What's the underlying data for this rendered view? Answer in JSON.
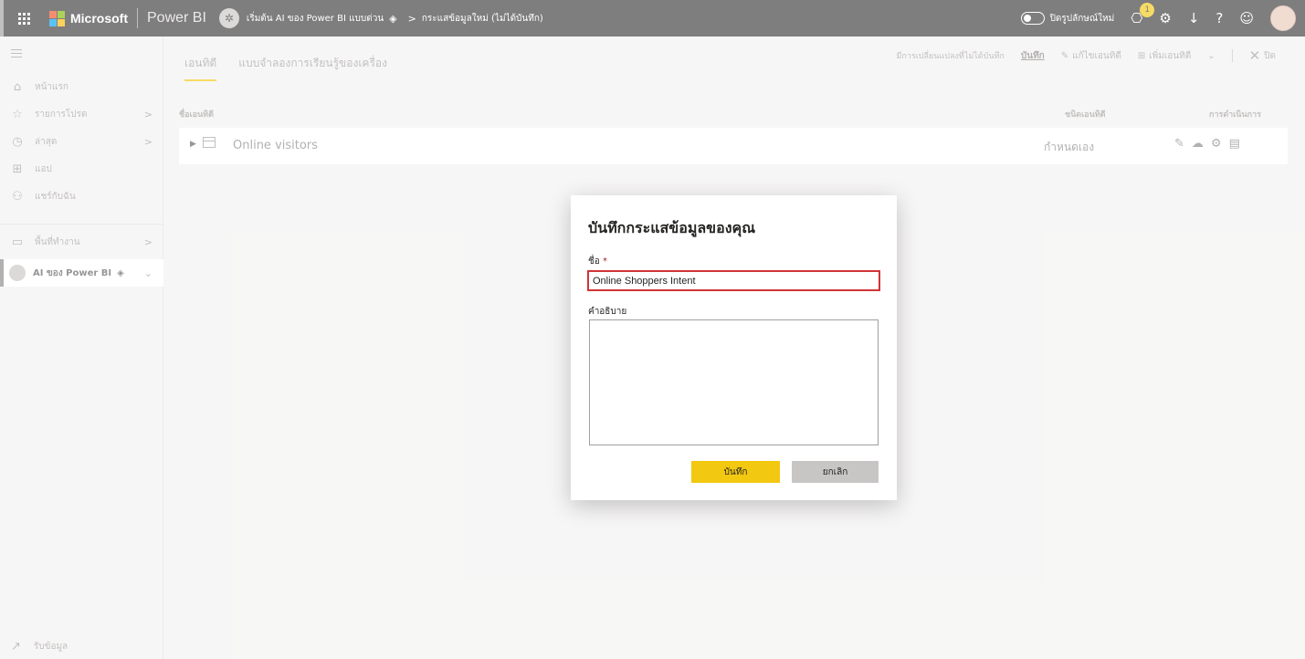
{
  "topbar": {
    "brand": "Microsoft",
    "app": "Power BI",
    "workspace_crumb": "เริ่มต้น AI ของ Power BI แบบด่วน",
    "page_crumb": "กระแสข้อมูลใหม่ (ไม่ได้บันทึก)",
    "new_look_label": "ปิดรูปลักษณ์ใหม่",
    "notification_count": "1"
  },
  "sidebar": {
    "items": [
      {
        "label": "หน้าแรก",
        "icon": "home-icon"
      },
      {
        "label": "รายการโปรด",
        "icon": "star-icon"
      },
      {
        "label": "ล่าสุด",
        "icon": "clock-icon"
      },
      {
        "label": "แอป",
        "icon": "apps-icon"
      },
      {
        "label": "แชร์กับฉัน",
        "icon": "shared-icon"
      },
      {
        "label": "พื้นที่ทำงาน",
        "icon": "workspaces-icon"
      }
    ],
    "active_workspace": "AI ของ Power BI",
    "get_data": "รับข้อมูล"
  },
  "main": {
    "tabs": [
      "เอนทิตี",
      "แบบจำลองการเรียนรู้ของเครื่อง"
    ],
    "toolbar": {
      "unsaved_note": "มีการเปลี่ยนแปลงที่ไม่ได้บันทึก",
      "save": "บันทึก",
      "edit_entity": "แก้ไขเอนทิตี",
      "add_entity": "เพิ่มเอนทิตี",
      "close": "ปิด"
    },
    "table": {
      "headers": {
        "name": "ชื่อเอนทิตี",
        "type": "ชนิดเอนทิตี",
        "actions": "การดำเนินการ"
      },
      "rows": [
        {
          "name": "Online visitors",
          "type": "กำหนดเอง"
        }
      ]
    }
  },
  "dialog": {
    "title": "บันทึกกระแสข้อมูลของคุณ",
    "name_label": "ชื่อ",
    "required_mark": "*",
    "name_value": "Online Shoppers Intent",
    "description_label": "คำอธิบาย",
    "description_value": "",
    "save_button": "บันทึก",
    "cancel_button": "ยกเลิก"
  },
  "colors": {
    "topbar": "#3b3a39",
    "accent_yellow": "#f2c811",
    "highlight_red": "#d13438"
  }
}
